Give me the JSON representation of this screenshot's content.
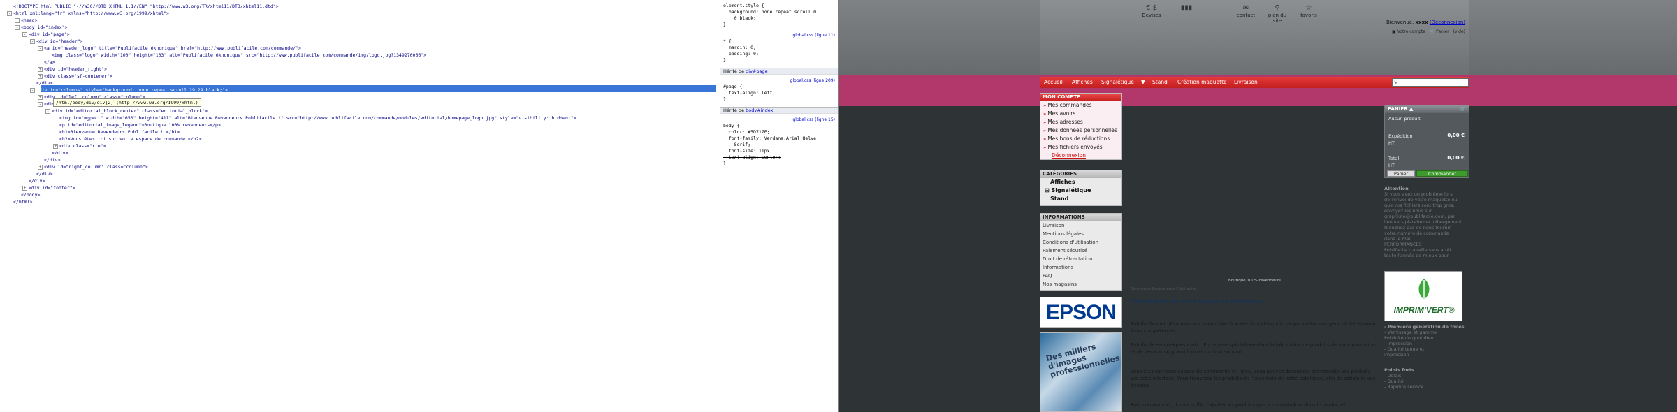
{
  "html_panel": {
    "lines": [
      {
        "indent": 0,
        "toggle": "",
        "text": "<!DOCTYPE html PUBLIC \"-//W3C//DTD XHTML 1.1//EN\" \"http://www.w3.org/TR/xhtml11/DTD/xhtml11.dtd\">"
      },
      {
        "indent": 0,
        "toggle": "-",
        "text": "<html xml:lang=\"fr\" xmlns=\"http://www.w3.org/1999/xhtml\">"
      },
      {
        "indent": 1,
        "toggle": "+",
        "text": "<head>"
      },
      {
        "indent": 1,
        "toggle": "-",
        "text": "<body id=\"index\">"
      },
      {
        "indent": 2,
        "toggle": "-",
        "text": "<div id=\"page\">"
      },
      {
        "indent": 3,
        "toggle": "-",
        "text": "<div id=\"header\">"
      },
      {
        "indent": 4,
        "toggle": "-",
        "text": "<a id=\"header_logo\" title=\"Publifacile éknonique\" href=\"http://www.publifacile.com/commande/\">"
      },
      {
        "indent": 5,
        "toggle": "",
        "text": "<img class=\"logo\" width=\"100\" height=\"103\" alt=\"Publifacile éknonique\" src=\"http://www.publifacile.com/commande/img/logo.jpg?1349270066\">"
      },
      {
        "indent": 4,
        "toggle": "",
        "text": "</a>"
      },
      {
        "indent": 4,
        "toggle": "+",
        "text": "<div id=\"header_right\">"
      },
      {
        "indent": 4,
        "toggle": "+",
        "text": "<div class=\"sf-contener\">"
      },
      {
        "indent": 3,
        "toggle": "",
        "text": "</div>"
      },
      {
        "indent": 3,
        "toggle": "-",
        "text": "<div id=\"columns\" style=\"background: none repeat scroll 29 29 black;\">"
      },
      {
        "indent": 4,
        "toggle": "+",
        "text": "<div id=\"left_column\" class=\"column\">"
      },
      {
        "indent": 4,
        "toggle": "-",
        "text": "<div id=\"center_column\">"
      },
      {
        "indent": 5,
        "toggle": "-",
        "text": "<div id=\"editorial_block_center\" class=\"editorial_block\">"
      },
      {
        "indent": 6,
        "toggle": "",
        "text": "<img id=\"mgpeci\" width=\"650\" height=\"411\" alt=\"Bienvenue Revendeurs Publifacile !\" src=\"http://www.publifacile.com/commande/modules/editorial/homepage_logo.jpg\" style=\"visibility: hidden;\">"
      },
      {
        "indent": 6,
        "toggle": "",
        "text": "<p id=\"editorial_image_legend\">Boutique 100% revendeurs</p>"
      },
      {
        "indent": 6,
        "toggle": "",
        "text": "<h1>Bienvenue Revendeurs Publifacile ! </h1>"
      },
      {
        "indent": 6,
        "toggle": "",
        "text": "<h2>Vous êtes ici sur votre espace de commande.</h2>"
      },
      {
        "indent": 6,
        "toggle": "+",
        "text": "<div class=\"rte\">"
      },
      {
        "indent": 5,
        "toggle": "",
        "text": "</div>"
      },
      {
        "indent": 4,
        "toggle": "",
        "text": "</div>"
      },
      {
        "indent": 4,
        "toggle": "+",
        "text": "<div id=\"right_column\" class=\"column\">"
      },
      {
        "indent": 3,
        "toggle": "",
        "text": "</div>"
      },
      {
        "indent": 2,
        "toggle": "",
        "text": "</div>"
      },
      {
        "indent": 2,
        "toggle": "+",
        "text": "<div id=\"footer\">"
      },
      {
        "indent": 1,
        "toggle": "",
        "text": "</body>"
      },
      {
        "indent": 0,
        "toggle": "",
        "text": "</html>"
      }
    ],
    "highlighted_index": 12,
    "tooltip": "/html/body/div/div[2] (http://www.w3.org/1999/xhtml)"
  },
  "css_panel": {
    "blocks": [
      {
        "kind": "rule",
        "lines": [
          "element.style {",
          "  background: none repeat scroll 0",
          "    0 black;",
          "}"
        ],
        "source": ""
      },
      {
        "kind": "rule",
        "lines": [
          "* {",
          "  margin: 0;",
          "  padding: 0;",
          "}"
        ],
        "source": "global.css (ligne 11)"
      },
      {
        "kind": "section",
        "label": "Hérité de ",
        "link": "div#page"
      },
      {
        "kind": "rule",
        "lines": [
          "#page {",
          "  text-align: left;",
          "}"
        ],
        "source": "global.css (ligne 209)"
      },
      {
        "kind": "section",
        "label": "Hérité de ",
        "link": "body#index"
      },
      {
        "kind": "rule",
        "lines": [
          "body {",
          "  color: #5D717E;",
          "  font-family: Verdana,Arial,Helve",
          "    Serif;",
          "  font-size: 11px;",
          "  text-align: center;",
          "}"
        ],
        "source": "global.css (ligne 15)"
      }
    ]
  },
  "site": {
    "header_icons": [
      {
        "name": "devises-icon",
        "glyph": "€ $",
        "label": "Devises"
      },
      {
        "name": "language-flag-icon",
        "glyph": "▮▮▮",
        "label": ""
      },
      {
        "name": "contact-icon",
        "glyph": "✉",
        "label": "contact"
      },
      {
        "name": "sitemap-icon",
        "glyph": "⚲",
        "label": "plan du site"
      },
      {
        "name": "favorites-icon",
        "glyph": "☆",
        "label": "favoris"
      }
    ],
    "welcome": "Bienvenue, ",
    "welcome_name": "xxxx",
    "logout": "(Déconnexion)",
    "account_link": "Votre compte",
    "cart_link": "Panier : (vide)",
    "nav": [
      "Accueil",
      "Affiches",
      "Signalétique",
      "▼",
      "Stand",
      "Création maquette",
      "Livraison"
    ],
    "account": {
      "title": "MON COMPTE",
      "items": [
        "Mes commandes",
        "Mes avoirs",
        "Mes adresses",
        "Mes données personnelles",
        "Mes bons de réductions",
        "Mes fichiers envoyés"
      ],
      "logout": "Déconnexion"
    },
    "categories": {
      "title": "CATÉGORIES",
      "items": [
        "Affiches",
        "⊞ Signalétique",
        "Stand"
      ]
    },
    "informations": {
      "title": "INFORMATIONS",
      "items": [
        "Livraison",
        "Mentions légales",
        "Conditions d'utilisation",
        "Paiement sécurisé",
        "Droit de rétractation",
        "Informations",
        "FAQ",
        "Nos magasins"
      ]
    },
    "epson": "EPSON",
    "catalog_text": "Des milliers d'images professionnelles",
    "center": {
      "legend": "Boutique 100% revendeurs",
      "h1": "Bienvenue Revendeurs Publifacile !",
      "h2": "Vous êtes ici sur votre espace de commande.",
      "p1": "Publifacile met désormais sur savoir-faire à votre disposition afin de permettre aux gens de faire-savoir leurs compétences.",
      "p2": "Publifacile en quelques mots : Entreprise spécialisée dans la fabrication de produits de communication et de décoration grand format sur tout support.",
      "p3": "Vous êtes sur votre espace de commande en ligne, vous pouvez désormais commander vos produits via cette interface. Vous trouverez les produits de l'ensemble de notre catalogue, afin de satisfaire vos besoins.",
      "p4": "Pour commander, il vous suffit d'ajouter les produits que vous souhaitez dans le panier, et"
    },
    "cart": {
      "title": "PANIER ▲",
      "empty": "Aucun produit",
      "shipping_label": "Expédition",
      "shipping_value": "0,00 €",
      "tax_label": "HT",
      "total_label": "Total",
      "total_value": "0,00 €",
      "total_tax": "HT",
      "btn_cart": "Panier",
      "btn_order": "Commander"
    },
    "right_text": [
      "Attention",
      "Si vous avez un problème lors",
      "de l'envoi de votre maquette ou",
      "que vos fichiers sont trop gros,",
      "envoyez les nous sur",
      "graphiste@publifacile.com, par",
      "lien vers plateforme hébergement.",
      "N'oubliez pas de nous fournir",
      "votre numéro de commande",
      "dans le mail.",
      "PERFORMANCES",
      "Publifacile travaille sans arrêt",
      "toute l'année de mieux pour"
    ],
    "imprim": "IMPRIM'VERT®",
    "right_text2": [
      "- Première génération de toiles",
      "- Vernissage et gamme",
      "  Publicité du quotidien",
      "- Impression",
      "- Qualité tenue et",
      "  impression"
    ],
    "right_text3": [
      "Points forts",
      "- Délais",
      "- Qualité",
      "- Rapidité service"
    ]
  },
  "colors": {
    "highlight": "#3875d7",
    "site_red": "#d32122",
    "site_pink": "#b2386b",
    "site_dark": "#2e3336"
  }
}
